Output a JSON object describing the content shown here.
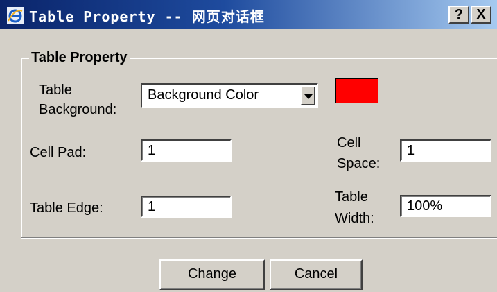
{
  "window": {
    "title": "Table Property -- 网页对话框",
    "help_label": "?",
    "close_label": "X",
    "icon": "ie-icon"
  },
  "group": {
    "legend": "Table Property"
  },
  "form": {
    "table_background": {
      "label_line1": "Table",
      "label_line2": "Background:",
      "value": "Background Color",
      "swatch_color": "#ff0000"
    },
    "cell_pad": {
      "label": "Cell Pad:",
      "value": "1"
    },
    "cell_space": {
      "label_line1": "Cell",
      "label_line2": "Space:",
      "value": "1"
    },
    "table_edge": {
      "label": "Table Edge:",
      "value": "1"
    },
    "table_width": {
      "label_line1": "Table",
      "label_line2": "Width:",
      "value": "100%"
    }
  },
  "buttons": {
    "change": "Change",
    "cancel": "Cancel"
  },
  "colors": {
    "title_start": "#0a246a",
    "title_end": "#a6caf0",
    "face": "#d4d0c8"
  }
}
